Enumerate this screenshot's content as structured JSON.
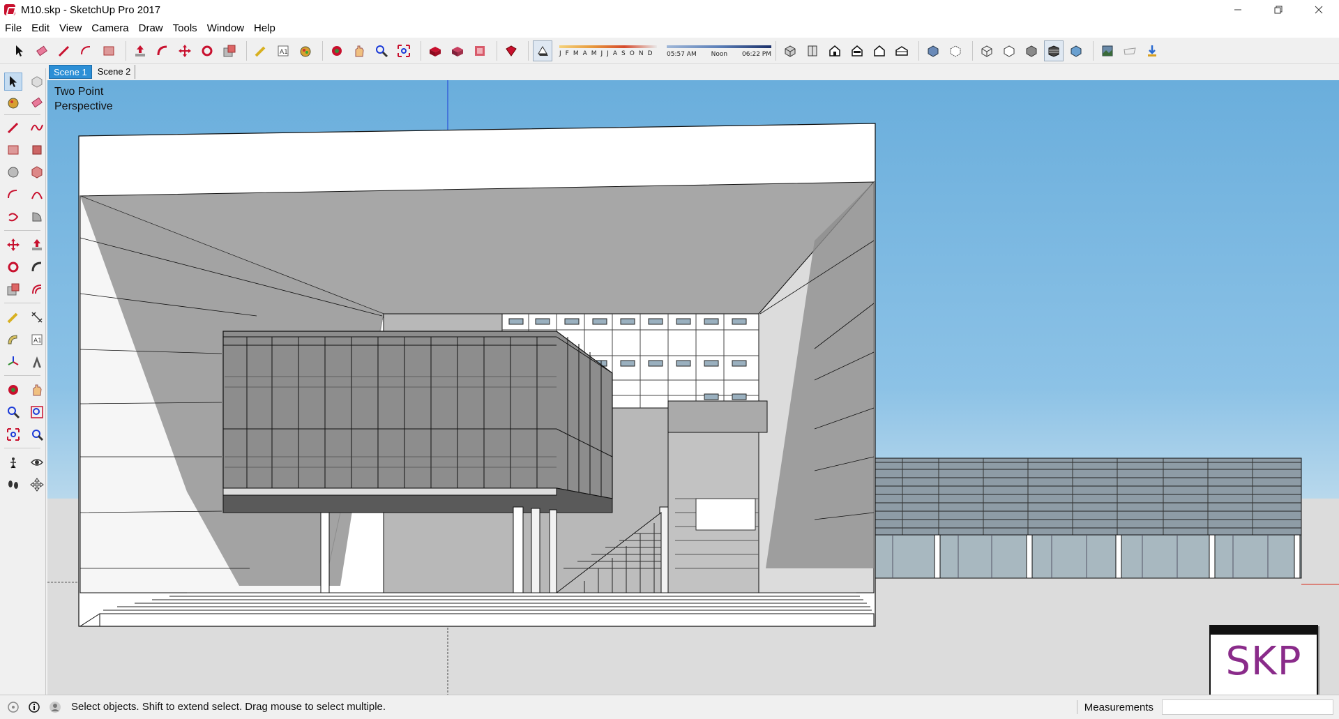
{
  "window": {
    "title": "M10.skp - SketchUp Pro 2017"
  },
  "menu": {
    "items": [
      "File",
      "Edit",
      "View",
      "Camera",
      "Draw",
      "Tools",
      "Window",
      "Help"
    ]
  },
  "toolbar": {
    "shadow": {
      "months": [
        "J",
        "F",
        "M",
        "A",
        "M",
        "J",
        "J",
        "A",
        "S",
        "O",
        "N",
        "D"
      ],
      "time_start": "05:57 AM",
      "time_mid": "Noon",
      "time_end": "06:22 PM"
    },
    "icons": [
      "select-icon",
      "eraser-icon",
      "pencil-icon",
      "arc-icon",
      "rectangle-icon",
      "push-pull-icon",
      "follow-me-icon",
      "move-icon",
      "rotate-icon",
      "scale-icon",
      "tape-measure-icon",
      "text-icon",
      "paint-bucket-icon",
      "orbit-icon",
      "pan-icon",
      "zoom-icon",
      "zoom-extents-icon",
      "warehouse-icon",
      "extension-warehouse-icon",
      "layout-icon",
      "extension-manager-icon",
      "shadows-toggle-icon",
      "iso-view-icon",
      "top-view-icon",
      "front-view-icon",
      "right-view-icon",
      "back-view-icon",
      "left-view-icon",
      "xray-icon",
      "back-edges-icon",
      "wireframe-icon",
      "hidden-line-icon",
      "shaded-icon",
      "shaded-textures-icon",
      "monochrome-icon",
      "photo-texture-icon",
      "add-location-icon",
      "export-icon"
    ]
  },
  "scenes": {
    "tabs": [
      "Scene 1",
      "Scene 2"
    ],
    "active": 0
  },
  "viewport": {
    "camera_label_line1": "Two Point",
    "camera_label_line2": "Perspective",
    "badge_text": "SKP",
    "colors": {
      "sky_top": "#6aaedc",
      "ground": "#dcdcdc",
      "axis_blue": "#1a3ad8",
      "axis_red": "#d82a1a"
    }
  },
  "status": {
    "message": "Select objects. Shift to extend select. Drag mouse to select multiple.",
    "measurements_label": "Measurements"
  }
}
